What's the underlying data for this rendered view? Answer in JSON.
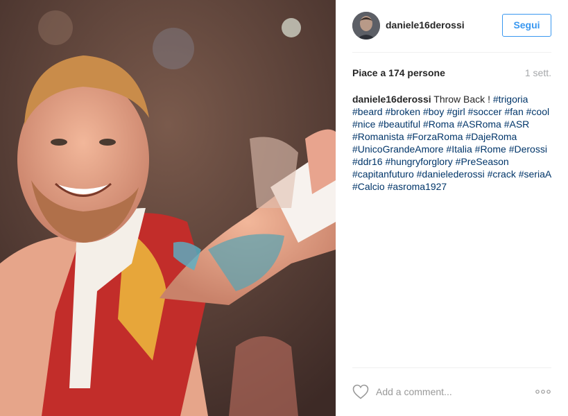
{
  "post": {
    "username": "daniele16derossi",
    "follow_label": "Segui",
    "likes_text": "Piace a 174 persone",
    "time_ago": "1 sett.",
    "caption": {
      "username": "daniele16derossi",
      "text": "Throw Back !",
      "hashtags": [
        "#trigoria",
        "#beard",
        "#broken",
        "#boy",
        "#girl",
        "#soccer",
        "#fan",
        "#cool",
        "#nice",
        "#beautiful",
        "#Roma",
        "#ASRoma",
        "#ASR",
        "#Romanista",
        "#ForzaRoma",
        "#DajeRoma",
        "#UnicoGrandeAmore",
        "#Italia",
        "#Rome",
        "#Derossi",
        "#ddr16",
        "#hungryforglory",
        "#PreSeason",
        "#capitanfuturo",
        "#daniele­derossi",
        "#crack",
        "#seriaA",
        "#Calcio",
        "#asroma1927"
      ]
    },
    "comment_placeholder": "Add a comment...",
    "icons": {
      "like": "heart-icon",
      "options": "more-options-icon"
    },
    "colors": {
      "accent": "#3897f0",
      "hashtag": "#003569",
      "text": "#262626",
      "muted": "#a5a7aa"
    }
  }
}
